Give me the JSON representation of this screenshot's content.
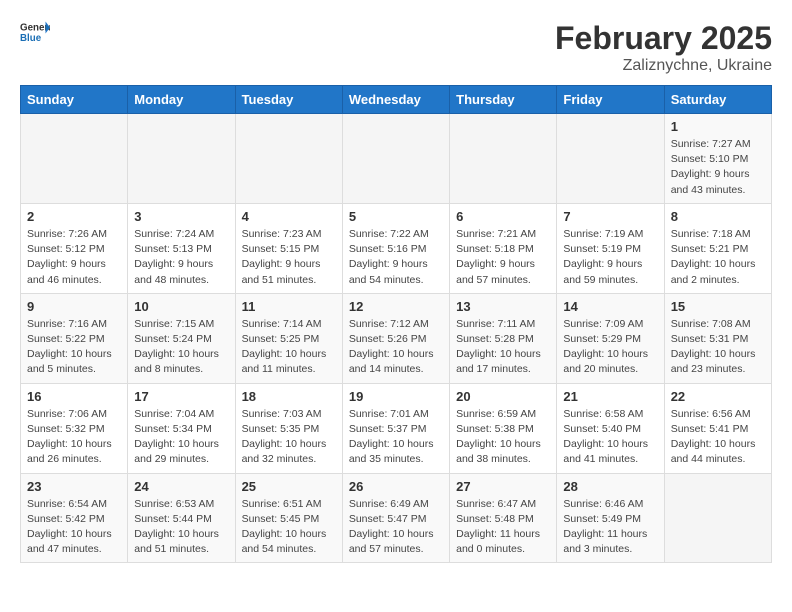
{
  "header": {
    "logo_general": "General",
    "logo_blue": "Blue",
    "month": "February 2025",
    "location": "Zaliznychne, Ukraine"
  },
  "weekdays": [
    "Sunday",
    "Monday",
    "Tuesday",
    "Wednesday",
    "Thursday",
    "Friday",
    "Saturday"
  ],
  "weeks": [
    [
      {
        "day": "",
        "detail": ""
      },
      {
        "day": "",
        "detail": ""
      },
      {
        "day": "",
        "detail": ""
      },
      {
        "day": "",
        "detail": ""
      },
      {
        "day": "",
        "detail": ""
      },
      {
        "day": "",
        "detail": ""
      },
      {
        "day": "1",
        "detail": "Sunrise: 7:27 AM\nSunset: 5:10 PM\nDaylight: 9 hours and 43 minutes."
      }
    ],
    [
      {
        "day": "2",
        "detail": "Sunrise: 7:26 AM\nSunset: 5:12 PM\nDaylight: 9 hours and 46 minutes."
      },
      {
        "day": "3",
        "detail": "Sunrise: 7:24 AM\nSunset: 5:13 PM\nDaylight: 9 hours and 48 minutes."
      },
      {
        "day": "4",
        "detail": "Sunrise: 7:23 AM\nSunset: 5:15 PM\nDaylight: 9 hours and 51 minutes."
      },
      {
        "day": "5",
        "detail": "Sunrise: 7:22 AM\nSunset: 5:16 PM\nDaylight: 9 hours and 54 minutes."
      },
      {
        "day": "6",
        "detail": "Sunrise: 7:21 AM\nSunset: 5:18 PM\nDaylight: 9 hours and 57 minutes."
      },
      {
        "day": "7",
        "detail": "Sunrise: 7:19 AM\nSunset: 5:19 PM\nDaylight: 9 hours and 59 minutes."
      },
      {
        "day": "8",
        "detail": "Sunrise: 7:18 AM\nSunset: 5:21 PM\nDaylight: 10 hours and 2 minutes."
      }
    ],
    [
      {
        "day": "9",
        "detail": "Sunrise: 7:16 AM\nSunset: 5:22 PM\nDaylight: 10 hours and 5 minutes."
      },
      {
        "day": "10",
        "detail": "Sunrise: 7:15 AM\nSunset: 5:24 PM\nDaylight: 10 hours and 8 minutes."
      },
      {
        "day": "11",
        "detail": "Sunrise: 7:14 AM\nSunset: 5:25 PM\nDaylight: 10 hours and 11 minutes."
      },
      {
        "day": "12",
        "detail": "Sunrise: 7:12 AM\nSunset: 5:26 PM\nDaylight: 10 hours and 14 minutes."
      },
      {
        "day": "13",
        "detail": "Sunrise: 7:11 AM\nSunset: 5:28 PM\nDaylight: 10 hours and 17 minutes."
      },
      {
        "day": "14",
        "detail": "Sunrise: 7:09 AM\nSunset: 5:29 PM\nDaylight: 10 hours and 20 minutes."
      },
      {
        "day": "15",
        "detail": "Sunrise: 7:08 AM\nSunset: 5:31 PM\nDaylight: 10 hours and 23 minutes."
      }
    ],
    [
      {
        "day": "16",
        "detail": "Sunrise: 7:06 AM\nSunset: 5:32 PM\nDaylight: 10 hours and 26 minutes."
      },
      {
        "day": "17",
        "detail": "Sunrise: 7:04 AM\nSunset: 5:34 PM\nDaylight: 10 hours and 29 minutes."
      },
      {
        "day": "18",
        "detail": "Sunrise: 7:03 AM\nSunset: 5:35 PM\nDaylight: 10 hours and 32 minutes."
      },
      {
        "day": "19",
        "detail": "Sunrise: 7:01 AM\nSunset: 5:37 PM\nDaylight: 10 hours and 35 minutes."
      },
      {
        "day": "20",
        "detail": "Sunrise: 6:59 AM\nSunset: 5:38 PM\nDaylight: 10 hours and 38 minutes."
      },
      {
        "day": "21",
        "detail": "Sunrise: 6:58 AM\nSunset: 5:40 PM\nDaylight: 10 hours and 41 minutes."
      },
      {
        "day": "22",
        "detail": "Sunrise: 6:56 AM\nSunset: 5:41 PM\nDaylight: 10 hours and 44 minutes."
      }
    ],
    [
      {
        "day": "23",
        "detail": "Sunrise: 6:54 AM\nSunset: 5:42 PM\nDaylight: 10 hours and 47 minutes."
      },
      {
        "day": "24",
        "detail": "Sunrise: 6:53 AM\nSunset: 5:44 PM\nDaylight: 10 hours and 51 minutes."
      },
      {
        "day": "25",
        "detail": "Sunrise: 6:51 AM\nSunset: 5:45 PM\nDaylight: 10 hours and 54 minutes."
      },
      {
        "day": "26",
        "detail": "Sunrise: 6:49 AM\nSunset: 5:47 PM\nDaylight: 10 hours and 57 minutes."
      },
      {
        "day": "27",
        "detail": "Sunrise: 6:47 AM\nSunset: 5:48 PM\nDaylight: 11 hours and 0 minutes."
      },
      {
        "day": "28",
        "detail": "Sunrise: 6:46 AM\nSunset: 5:49 PM\nDaylight: 11 hours and 3 minutes."
      },
      {
        "day": "",
        "detail": ""
      }
    ]
  ]
}
